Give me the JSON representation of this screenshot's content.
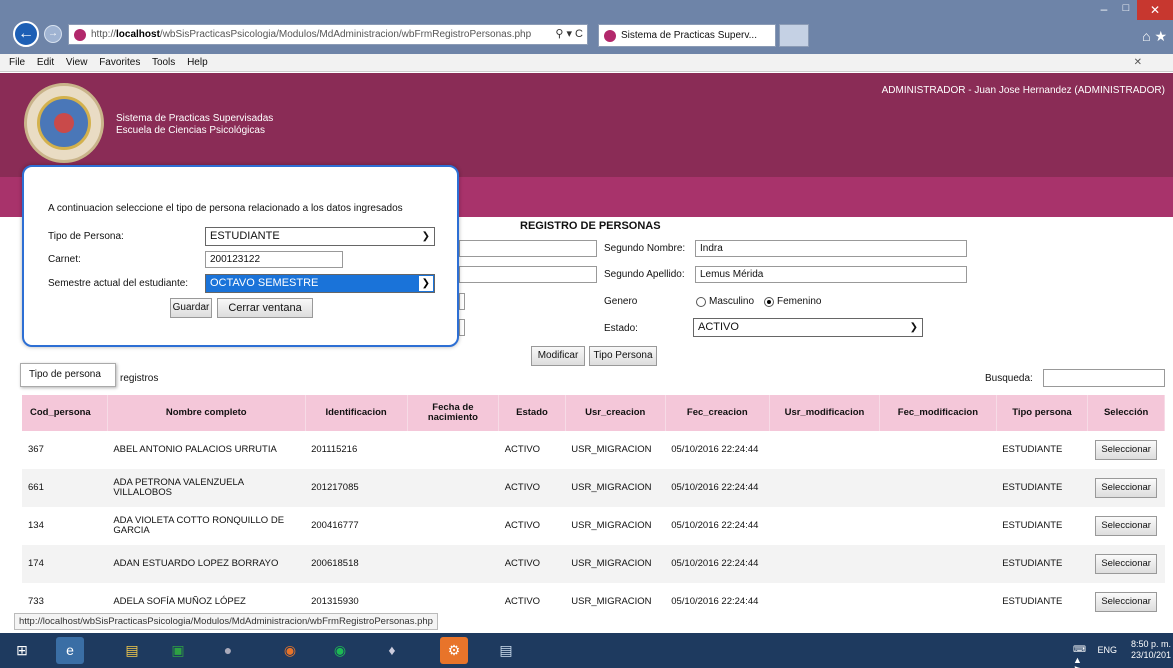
{
  "browser": {
    "url_prefix": "http://",
    "url_host": "localhost",
    "url_path": "/wbSisPracticasPsicologia/Modulos/MdAdministracion/wbFrmRegistroPersonas.php",
    "tab_title": "Sistema de Practicas Superv...",
    "menu": [
      "File",
      "Edit",
      "View",
      "Favorites",
      "Tools",
      "Help"
    ]
  },
  "header": {
    "system_name": "Sistema de Practicas Supervisadas",
    "school_name": "Escuela de Ciencias Psicológicas",
    "current_user": "ADMINISTRADOR - Juan Jose Hernandez (ADMINISTRADOR)"
  },
  "form": {
    "title": "REGISTRO DE PERSONAS",
    "segundo_nombre_label": "Segundo Nombre:",
    "segundo_nombre_value": "Indra",
    "segundo_apellido_label": "Segundo Apellido:",
    "segundo_apellido_value": "Lemus Mérida",
    "genero_label": "Genero",
    "masculino_label": "Masculino",
    "femenino_label": "Femenino",
    "genero_value": "Femenino",
    "estado_label": "Estado:",
    "estado_value": "ACTIVO",
    "modificar_button": "Modificar",
    "tipo_persona_button": "Tipo Persona"
  },
  "modal": {
    "instruction": "A continuacion seleccione el tipo de persona relacionado a los datos ingresados",
    "tipo_label": "Tipo de Persona:",
    "tipo_value": "ESTUDIANTE",
    "carnet_label": "Carnet:",
    "carnet_value": "200123122",
    "semestre_label": "Semestre actual del estudiante:",
    "semestre_value": "OCTAVO SEMESTRE",
    "guardar_button": "Guardar",
    "cerrar_button": "Cerrar ventana"
  },
  "table": {
    "tab_label": "Tipo de persona",
    "registros_label": "registros",
    "busqueda_label": "Busqueda:",
    "headers": [
      "Cod_persona",
      "Nombre completo",
      "Identificacion",
      "Fecha de nacimiento",
      "Estado",
      "Usr_creacion",
      "Fec_creacion",
      "Usr_modificacion",
      "Fec_modificacion",
      "Tipo persona",
      "Selección"
    ],
    "rows": [
      {
        "cod": "367",
        "nombre": "ABEL ANTONIO PALACIOS URRUTIA",
        "id": "201115216",
        "fecha_nac": "",
        "estado": "ACTIVO",
        "usr_creacion": "USR_MIGRACION",
        "fec_creacion": "05/10/2016 22:24:44",
        "usr_mod": "",
        "fec_mod": "",
        "tipo": "ESTUDIANTE",
        "btn": "Seleccionar"
      },
      {
        "cod": "661",
        "nombre": "ADA PETRONA VALENZUELA VILLALOBOS",
        "id": "201217085",
        "fecha_nac": "",
        "estado": "ACTIVO",
        "usr_creacion": "USR_MIGRACION",
        "fec_creacion": "05/10/2016 22:24:44",
        "usr_mod": "",
        "fec_mod": "",
        "tipo": "ESTUDIANTE",
        "btn": "Seleccionar"
      },
      {
        "cod": "134",
        "nombre": "ADA VIOLETA COTTO RONQUILLO DE GARCIA",
        "id": "200416777",
        "fecha_nac": "",
        "estado": "ACTIVO",
        "usr_creacion": "USR_MIGRACION",
        "fec_creacion": "05/10/2016 22:24:44",
        "usr_mod": "",
        "fec_mod": "",
        "tipo": "ESTUDIANTE",
        "btn": "Seleccionar"
      },
      {
        "cod": "174",
        "nombre": "ADAN ESTUARDO LOPEZ BORRAYO",
        "id": "200618518",
        "fecha_nac": "",
        "estado": "ACTIVO",
        "usr_creacion": "USR_MIGRACION",
        "fec_creacion": "05/10/2016 22:24:44",
        "usr_mod": "",
        "fec_mod": "",
        "tipo": "ESTUDIANTE",
        "btn": "Seleccionar"
      },
      {
        "cod": "733",
        "nombre": "ADELA SOFÍA MUÑOZ LÓPEZ",
        "id": "201315930",
        "fecha_nac": "",
        "estado": "ACTIVO",
        "usr_creacion": "USR_MIGRACION",
        "fec_creacion": "05/10/2016 22:24:44",
        "usr_mod": "",
        "fec_mod": "",
        "tipo": "ESTUDIANTE",
        "btn": "Seleccionar"
      }
    ]
  },
  "status_bar": {
    "url": "http://localhost/wbSisPracticasPsicologia/Modulos/MdAdministracion/wbFrmRegistroPersonas.php"
  },
  "taskbar": {
    "language": "ENG",
    "time": "8:50 p. m.",
    "date": "23/10/201"
  },
  "colors": {
    "header_bg": "#8a2c56",
    "subheader_bg": "#a8336b",
    "table_header_bg": "#f4c7d9",
    "modal_border": "#2d6fd4",
    "selected_option_bg": "#1a73d9"
  }
}
